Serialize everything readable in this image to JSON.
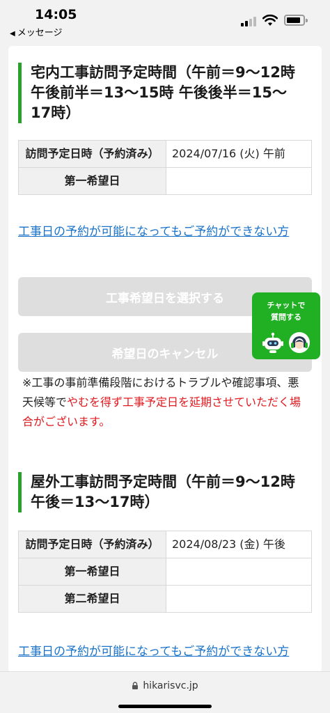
{
  "status_bar": {
    "time": "14:05",
    "back_app": "メッセージ"
  },
  "sections": [
    {
      "title": "宅内工事訪問予定時間（午前＝9〜12時 午後前半＝13〜15時 午後後半＝15〜17時）",
      "rows": [
        {
          "label": "訪問予定日時（予約済み）",
          "value": "2024/07/16 (火) 午前"
        },
        {
          "label": "第一希望日",
          "value": ""
        }
      ],
      "link": "工事日の予約が可能になってもご予約ができない方",
      "buttons": {
        "select": "工事希望日を選択する",
        "cancel": "希望日のキャンセル"
      },
      "notice": {
        "normal": "※工事の事前準備段階におけるトラブルや確認事項、悪天候等で",
        "red": "やむを得ず工事予定日を延期させていただく場合がございます。"
      }
    },
    {
      "title": "屋外工事訪問予定時間（午前＝9〜12時 午後＝13〜17時）",
      "rows": [
        {
          "label": "訪問予定日時（予約済み）",
          "value": "2024/08/23 (金) 午後"
        },
        {
          "label": "第一希望日",
          "value": ""
        },
        {
          "label": "第二希望日",
          "value": ""
        }
      ],
      "link": "工事日の予約が可能になってもご予約ができない方"
    }
  ],
  "chat_widget": {
    "label": "チャットで質問する"
  },
  "url_bar": {
    "domain": "hikarisvc.jp"
  },
  "colors": {
    "accent_green": "#2aa12a",
    "link_blue": "#1a73c9",
    "warning_red": "#e0191f",
    "chat_green": "#21b024"
  }
}
